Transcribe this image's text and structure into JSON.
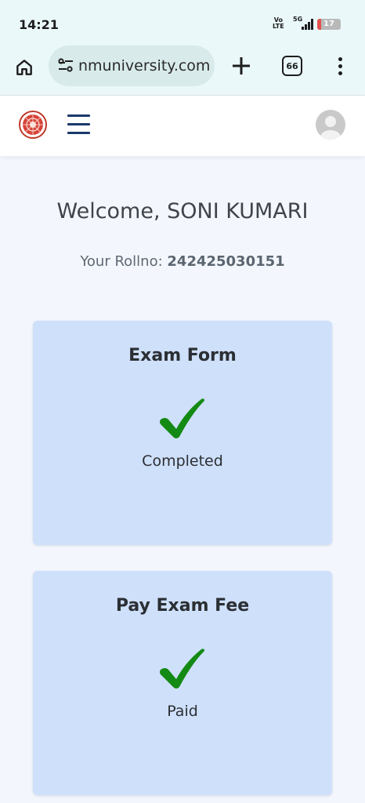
{
  "status_bar": {
    "time": "14:21",
    "volte_top": "Vo",
    "volte_bottom": "LTE",
    "network": "5G",
    "battery": 17,
    "battery_text": "17"
  },
  "browser": {
    "url": "nmuniversity.com",
    "tab_count": "66",
    "icons": [
      "home-icon",
      "site-settings-icon",
      "new-tab-icon",
      "tab-switcher-icon",
      "more-vert-icon"
    ]
  },
  "header": {
    "icons": [
      "university-logo",
      "hamburger-menu-icon",
      "user-avatar-icon"
    ]
  },
  "main": {
    "welcome_prefix": "Welcome, ",
    "student_name": "SONI KUMARI",
    "rollno_label": "Your Rollno: ",
    "rollno_value": "242425030151",
    "cards": [
      {
        "title": "Exam Form",
        "status": "Completed",
        "icon": "check-icon",
        "icon_color": "#138a13"
      },
      {
        "title": "Pay Exam Fee",
        "status": "Paid",
        "icon": "check-icon",
        "icon_color": "#138a13"
      }
    ]
  },
  "colors": {
    "card_bg": "#cfe0fb",
    "page_bg": "#f3f7fd",
    "browser_bg": "#eaf8fa",
    "menu_icon": "#1a3a6b"
  }
}
